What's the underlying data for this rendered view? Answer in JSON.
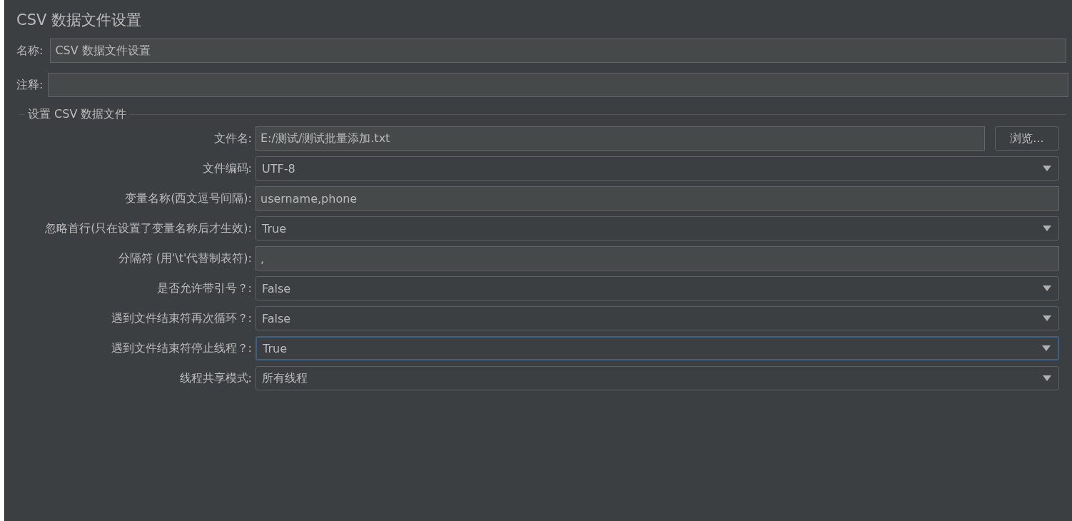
{
  "title": "CSV 数据文件设置",
  "name_field": {
    "label": "名称:",
    "value": "CSV 数据文件设置"
  },
  "comment_field": {
    "label": "注释:"
  },
  "group": {
    "title": "设置 CSV 数据文件",
    "rows": [
      {
        "kind": "file",
        "label": "文件名:",
        "value": "E:/测试/测试批量添加.txt",
        "button": "浏览...",
        "focused": false
      },
      {
        "kind": "select",
        "label": "文件编码:",
        "value": "UTF-8",
        "focused": false
      },
      {
        "kind": "text",
        "label": "变量名称(西文逗号间隔):",
        "value": "username,phone",
        "focused": false
      },
      {
        "kind": "select",
        "label": "忽略首行(只在设置了变量名称后才生效):",
        "value": "True",
        "focused": false
      },
      {
        "kind": "text",
        "label": "分隔符 (用'\\t'代替制表符):",
        "value": ",",
        "focused": false
      },
      {
        "kind": "select",
        "label": "是否允许带引号？:",
        "value": "False",
        "focused": false
      },
      {
        "kind": "select",
        "label": "遇到文件结束符再次循环？:",
        "value": "False",
        "focused": false
      },
      {
        "kind": "select",
        "label": "遇到文件结束符停止线程？:",
        "value": "True",
        "focused": true
      },
      {
        "kind": "select",
        "label": "线程共享模式:",
        "value": "所有线程",
        "focused": false
      }
    ]
  }
}
